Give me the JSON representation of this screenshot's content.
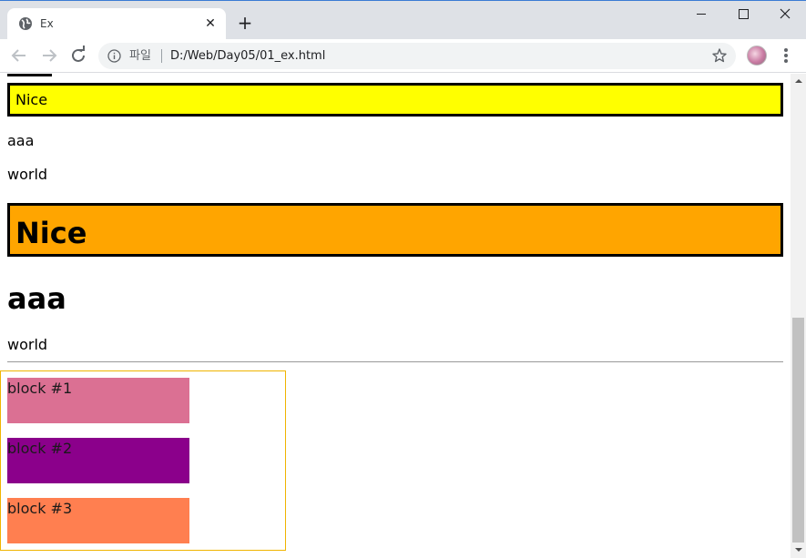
{
  "browser": {
    "tab": {
      "title": "Ex",
      "icon": "globe-icon",
      "close_icon": "close-icon"
    },
    "new_tab_icon": "plus-icon",
    "window_controls": [
      "minimize-icon",
      "maximize-icon",
      "close-icon"
    ],
    "toolbar": {
      "back_icon": "arrow-left-icon",
      "forward_icon": "arrow-right-icon",
      "reload_icon": "reload-icon",
      "info_icon": "info-icon",
      "scheme_label": "파일",
      "url": "D:/Web/Day05/01_ex.html",
      "bookmark_icon": "star-icon",
      "menu_icon": "kebab-menu-icon"
    },
    "accent_color": "#3b7bd4"
  },
  "page": {
    "yellow_box": {
      "text": "Nice",
      "background": "#ffff00"
    },
    "para_aaa": "aaa",
    "para_world_1": "world",
    "orange_box": {
      "text": "Nice",
      "background": "#ffa500"
    },
    "heading_aaa": "aaa",
    "para_world_2": "world",
    "blocks": [
      {
        "label": "block #1",
        "color": "#db7093"
      },
      {
        "label": "block #2",
        "color": "#8b008b"
      },
      {
        "label": "block #3",
        "color": "#ff7f50"
      }
    ],
    "container_border_color": "#f0b400"
  }
}
